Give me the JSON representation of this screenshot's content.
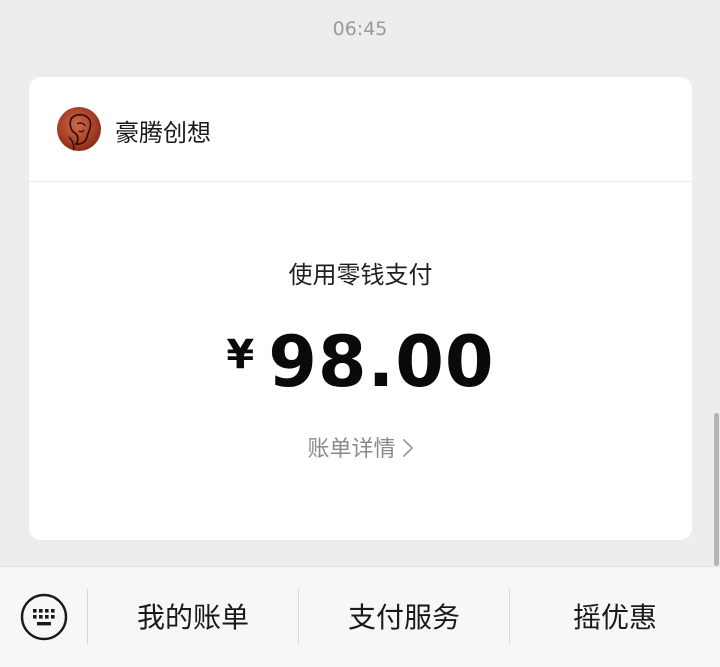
{
  "timestamp": "06:45",
  "merchant": {
    "name": "豪腾创想"
  },
  "payment": {
    "method": "使用零钱支付",
    "currency_symbol": "¥",
    "amount": "98.00",
    "detail_link": "账单详情"
  },
  "bottom_menu": {
    "items": [
      {
        "label": "我的账单"
      },
      {
        "label": "支付服务"
      },
      {
        "label": "摇优惠"
      }
    ]
  },
  "icons": {
    "keyboard": "keyboard-icon",
    "chevron": "chevron-right-icon"
  },
  "colors": {
    "background": "#ededed",
    "card": "#ffffff",
    "muted_text": "#8a8a8a"
  }
}
